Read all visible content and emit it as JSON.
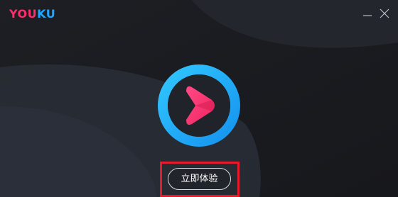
{
  "app": {
    "logo_part1": "YOU",
    "logo_part2": "KU",
    "brand_pink": "#ff2d6a",
    "brand_blue": "#1ea7ff"
  },
  "window_controls": {
    "minimize_icon": "minimize-icon",
    "close_icon": "close-icon"
  },
  "main": {
    "center_icon": "youku-play-logo-icon",
    "cta_label": "立即体验",
    "highlight_color": "#e31b2b"
  }
}
